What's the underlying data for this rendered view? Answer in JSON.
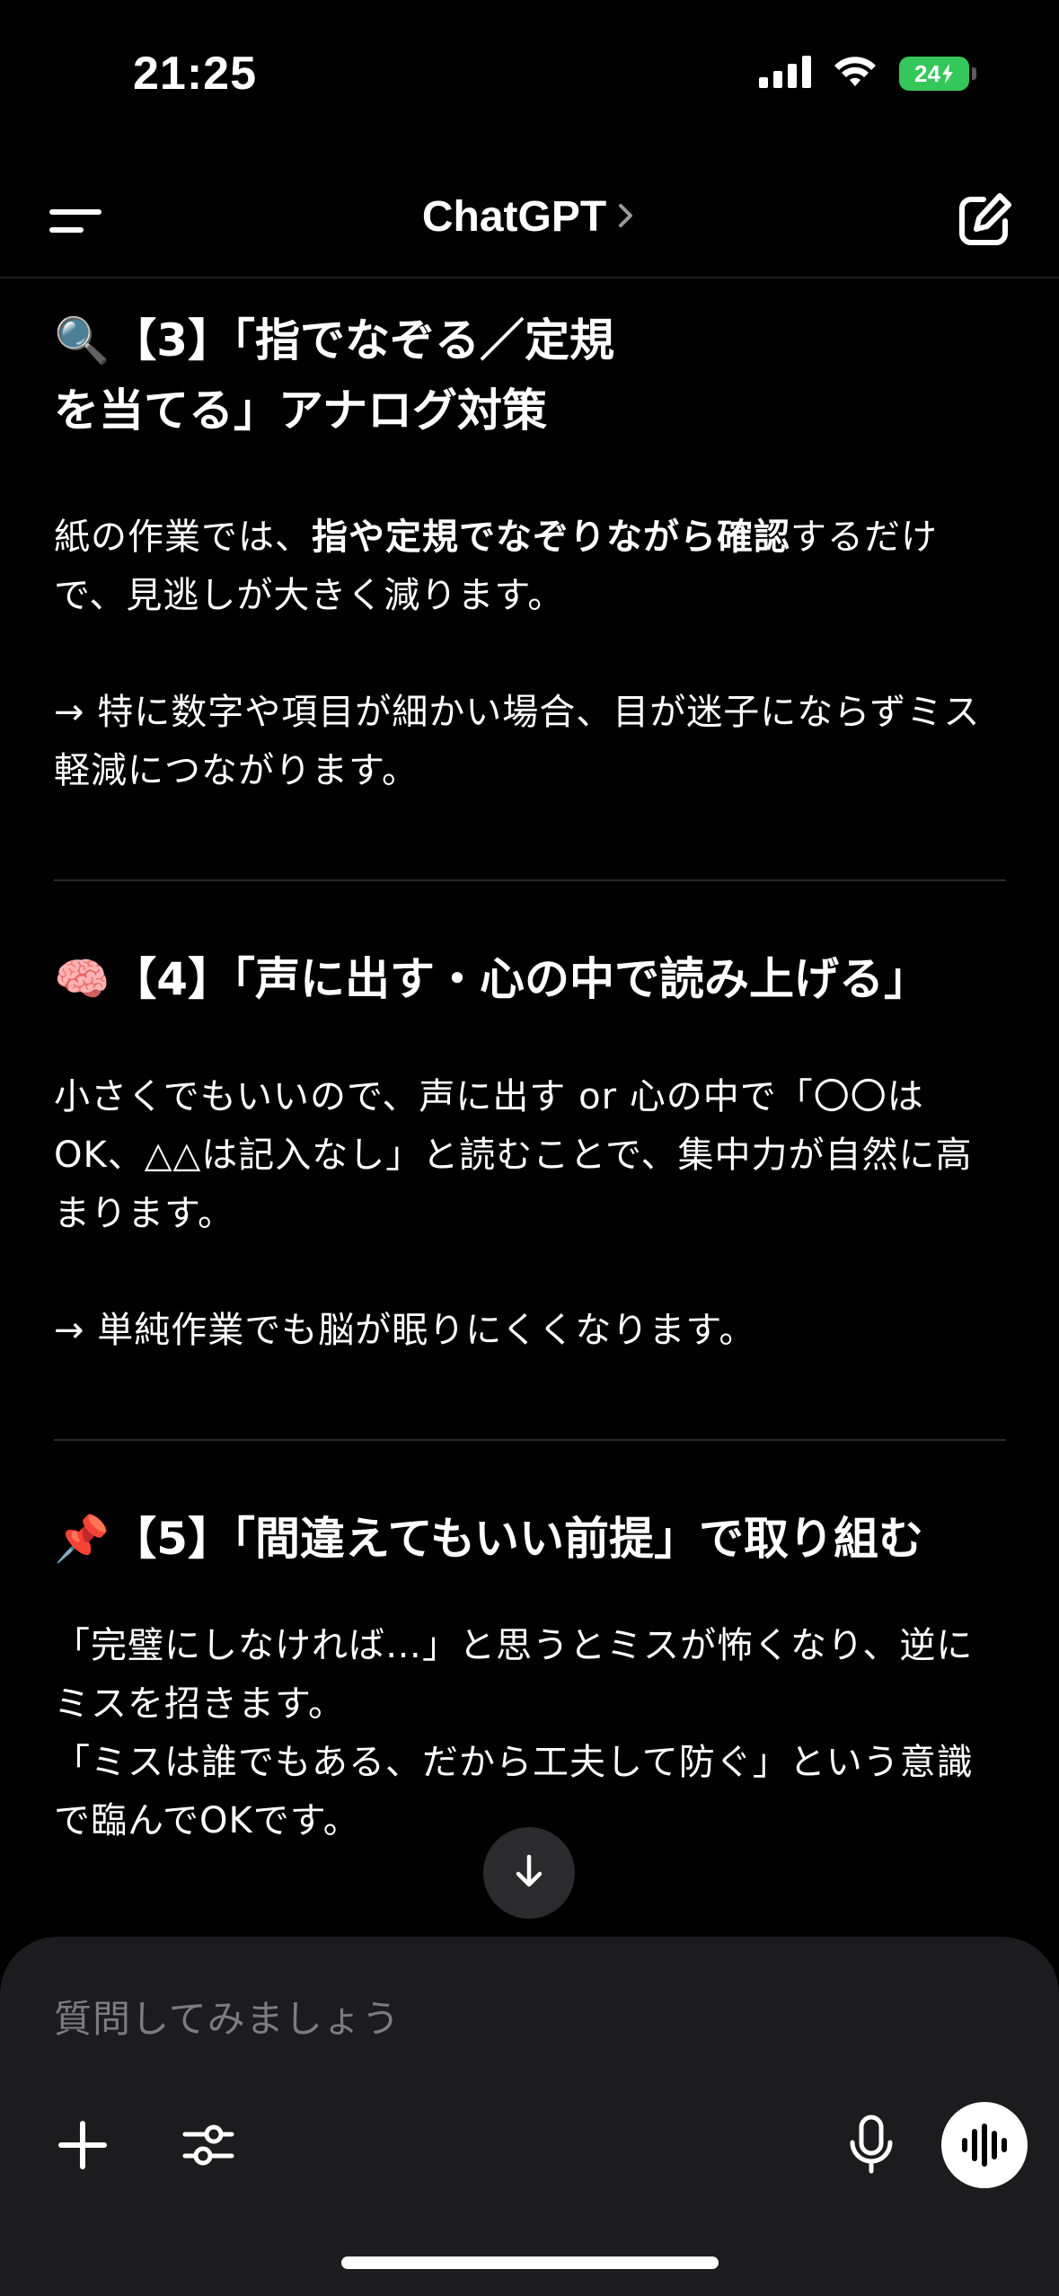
{
  "status_bar": {
    "time": "21:25",
    "battery": "24",
    "icons": [
      "cellular-signal-icon",
      "wifi-icon",
      "battery-charging-icon"
    ]
  },
  "header": {
    "title": "ChatGPT",
    "chevron": "›",
    "icons": [
      "menu-icon",
      "new-chat-icon"
    ]
  },
  "sections": [
    {
      "emoji": "🔍",
      "title_line1": "【3】「指でなぞる／定規",
      "title_line2": "を当てる」アナログ対策",
      "p1_pre": "紙の作業では、",
      "p1_bold": "指や定規でなぞりながら確認",
      "p1_post": "するだけで、見逃しが大きく減ります。",
      "p2": "→ 特に数字や項目が細かい場合、目が迷子にならずミス軽減につながります。"
    },
    {
      "emoji": "🧠",
      "title": "【4】「声に出す・心の中で読み上げる」",
      "p1": "小さくでもいいので、声に出す or 心の中で「〇〇はOK、△△は記入なし」と読むことで、集中力が自然に高まります。",
      "p2": "→ 単純作業でも脳が眠りにくくなります。"
    },
    {
      "emoji": "📌",
      "title": "【5】「間違えてもいい前提」で取り組む",
      "p1": "「完璧にしなければ…」と思うとミスが怖くなり、逆にミスを招きます。",
      "p2": "「ミスは誰でもある、だから工夫して防ぐ」という意識で臨んでOKです。"
    }
  ],
  "composer": {
    "placeholder": "質問してみましょう",
    "icons": [
      "plus-icon",
      "tools-sliders-icon",
      "microphone-icon",
      "voice-mode-icon"
    ]
  },
  "scroll_button_icon": "arrow-down-icon",
  "colors": {
    "background": "#000000",
    "composer": "#1c1c1e",
    "battery": "#34c759",
    "placeholder": "#7c7c80"
  }
}
